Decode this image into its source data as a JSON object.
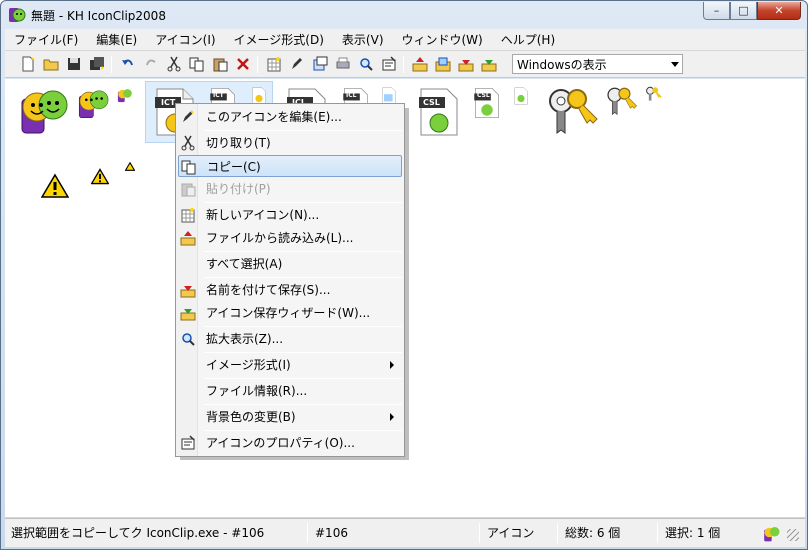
{
  "window": {
    "title": "無題 - KH IconClip2008",
    "minimize_glyph": "–",
    "maximize_glyph": "□",
    "close_glyph": "✕"
  },
  "menubar": {
    "items": [
      {
        "label": "ファイル(F)"
      },
      {
        "label": "編集(E)"
      },
      {
        "label": "アイコン(I)"
      },
      {
        "label": "イメージ形式(D)"
      },
      {
        "label": "表示(V)"
      },
      {
        "label": "ウィンドウ(W)"
      },
      {
        "label": "ヘルプ(H)"
      }
    ]
  },
  "toolbar": {
    "view_select_value": "Windowsの表示"
  },
  "canvas": {
    "icon_labels": {
      "ict": "ICT",
      "icl": "ICL",
      "csl": "CSL"
    }
  },
  "context_menu": {
    "items": [
      {
        "label": "このアイコンを編集(E)...",
        "icon": "pencil-icon"
      },
      {
        "label": "切り取り(T)",
        "icon": "scissors-icon"
      },
      {
        "label": "コピー(C)",
        "icon": "copy-icon",
        "highlighted": true
      },
      {
        "label": "貼り付け(P)",
        "icon": "paste-icon",
        "disabled": true
      },
      {
        "label": "新しいアイコン(N)...",
        "icon": "new-icon-grid-icon"
      },
      {
        "label": "ファイルから読み込み(L)...",
        "icon": "load-from-file-icon"
      },
      {
        "label": "すべて選択(A)",
        "icon": ""
      },
      {
        "label": "名前を付けて保存(S)...",
        "icon": "save-as-icon"
      },
      {
        "label": "アイコン保存ウィザード(W)...",
        "icon": "save-wizard-icon"
      },
      {
        "label": "拡大表示(Z)...",
        "icon": "magnifier-icon"
      },
      {
        "label": "イメージ形式(I)",
        "icon": "",
        "submenu": true
      },
      {
        "label": "ファイル情報(R)...",
        "icon": ""
      },
      {
        "label": "背景色の変更(B)",
        "icon": "",
        "submenu": true
      },
      {
        "label": "アイコンのプロパティ(O)...",
        "icon": "properties-icon"
      }
    ]
  },
  "statusbar": {
    "message": "選択範囲をコピーしてク IconClip.exe - #106",
    "index": "#106",
    "type": "アイコン",
    "total": "総数: 6 個",
    "selected": "選択: 1 個"
  },
  "colors": {
    "highlight_border": "#7da2ce",
    "warning_yellow": "#ffd500",
    "smiley_green": "#7ccf3c",
    "smiley_yellow": "#f5c51a",
    "purple": "#7a2fb0"
  }
}
